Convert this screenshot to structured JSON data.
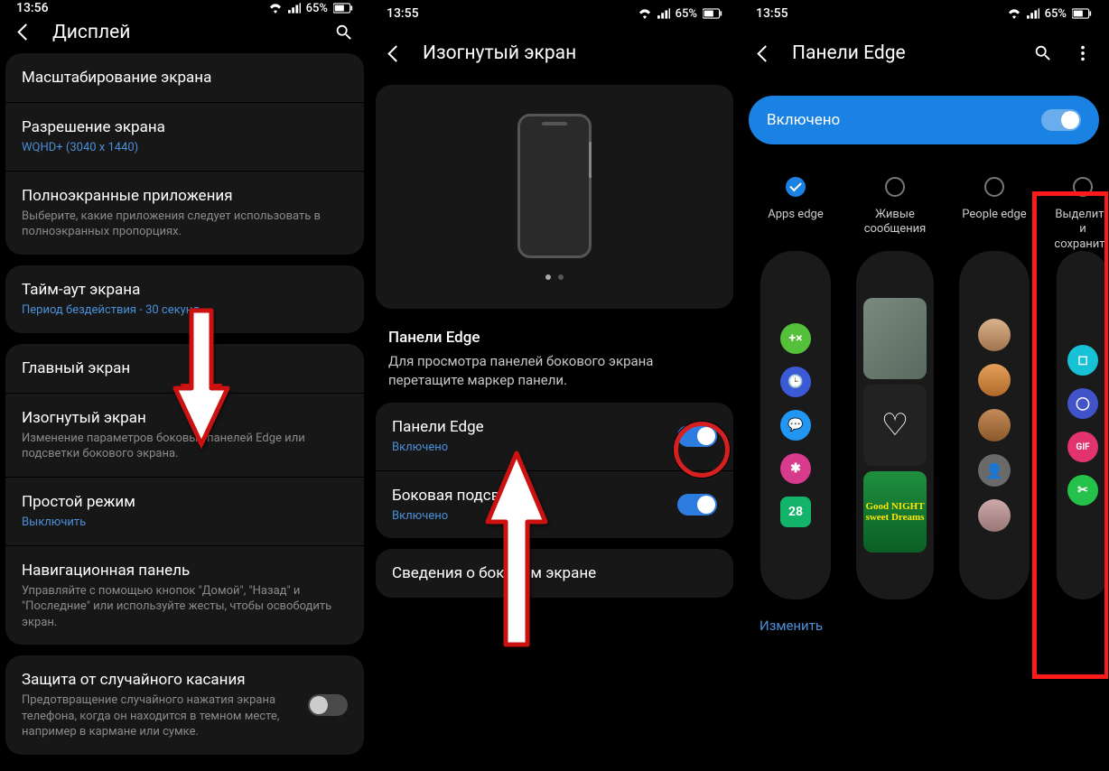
{
  "status": {
    "time1": "13:56",
    "time2": "13:55",
    "time3": "13:55",
    "batt": "65%"
  },
  "s1": {
    "title": "Дисплей",
    "scale": "Масштабирование экрана",
    "res_t": "Разрешение экрана",
    "res_s": "WQHD+ (3040 х 1440)",
    "full_t": "Полноэкранные приложения",
    "full_s": "Выберите, какие приложения следует использовать в полноэкранных пропорциях.",
    "tout_t": "Тайм-аут экрана",
    "tout_s": "Период бездействия - 30 секунд",
    "home": "Главный экран",
    "edge_t": "Изогнутый экран",
    "edge_s": "Изменение параметров боковых панелей Edge или подсветки бокового экрана.",
    "easy_t": "Простой режим",
    "easy_s": "Выключить",
    "nav_t": "Навигационная панель",
    "nav_s": "Управляйте с помощью кнопок \"Домой\", \"Назад\" и \"Последние\" или используйте жесты, чтобы освободить экран.",
    "touch_t": "Защита от случайного касания",
    "touch_s": "Предотвращение случайного нажатия экрана телефона, когда он находится в темном месте, например в кармане или сумке."
  },
  "s2": {
    "title": "Изогнутый экран",
    "desc_h": "Панели Edge",
    "desc_p": "Для просмотра панелей бокового экрана перетащите маркер панели.",
    "edge_t": "Панели Edge",
    "edge_s": "Включено",
    "light_t": "Боковая подсветка",
    "light_s": "Включено",
    "about": "Сведения о боковом экране"
  },
  "s3": {
    "title": "Панели Edge",
    "enabled": "Включено",
    "panels": [
      {
        "label": "Apps edge",
        "checked": true
      },
      {
        "label": "Живые сообщения",
        "checked": false
      },
      {
        "label": "People edge",
        "checked": false
      },
      {
        "label": "Выделить и сохранить",
        "checked": false
      }
    ],
    "apps": [
      {
        "bg": "#55c03a",
        "txt": "+×"
      },
      {
        "bg": "#3b5ad6",
        "txt": "🕒"
      },
      {
        "bg": "#2196f3",
        "txt": "💬"
      },
      {
        "bg": "#d83a8c",
        "txt": "✱"
      },
      {
        "bg": "#14b36a",
        "txt": "28"
      }
    ],
    "tools": [
      {
        "bg": "#17c1d6"
      },
      {
        "bg": "#4153c9"
      },
      {
        "bg": "#e2336e"
      },
      {
        "bg": "#24c24a"
      }
    ],
    "gn": "Good NIGHT sweet Dreams",
    "edit": "Изменить"
  }
}
